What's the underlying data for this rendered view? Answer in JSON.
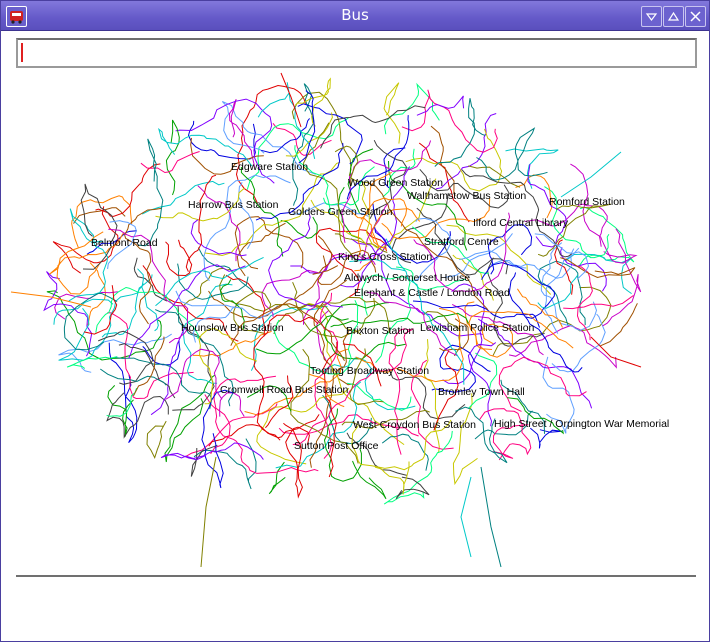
{
  "window": {
    "title": "Bus"
  },
  "search": {
    "value": "",
    "placeholder": ""
  },
  "status": {
    "text": ""
  },
  "map": {
    "labels": [
      {
        "text": "Edgware Station"
      },
      {
        "text": "Wood Green Station"
      },
      {
        "text": "Walthamstow Bus Station"
      },
      {
        "text": "Romford Station"
      },
      {
        "text": "Harrow Bus Station"
      },
      {
        "text": "Golders Green Station"
      },
      {
        "text": "Ilford Central Library"
      },
      {
        "text": "Belmont Road"
      },
      {
        "text": "Stratford Centre"
      },
      {
        "text": "King's Cross Station"
      },
      {
        "text": "Aldwych / Somerset House"
      },
      {
        "text": "Elephant & Castle / London Road"
      },
      {
        "text": "Hounslow Bus Station"
      },
      {
        "text": "Brixton Station"
      },
      {
        "text": "Lewisham Police Station"
      },
      {
        "text": "Tooting Broadway Station"
      },
      {
        "text": "Cromwell Road Bus Station"
      },
      {
        "text": "Bromley Town Hall"
      },
      {
        "text": "West Croydon Bus Station"
      },
      {
        "text": "High Street / Orpington War Memorial"
      },
      {
        "text": "Sutton Post Office"
      }
    ],
    "route_colors": [
      "#e00000",
      "#00a000",
      "#0000e0",
      "#00c8c8",
      "#c800c8",
      "#c8c800",
      "#ff8000",
      "#8000ff",
      "#00ff80",
      "#808000",
      "#ff0080",
      "#404040",
      "#008080",
      "#a05000",
      "#60a0ff"
    ]
  }
}
